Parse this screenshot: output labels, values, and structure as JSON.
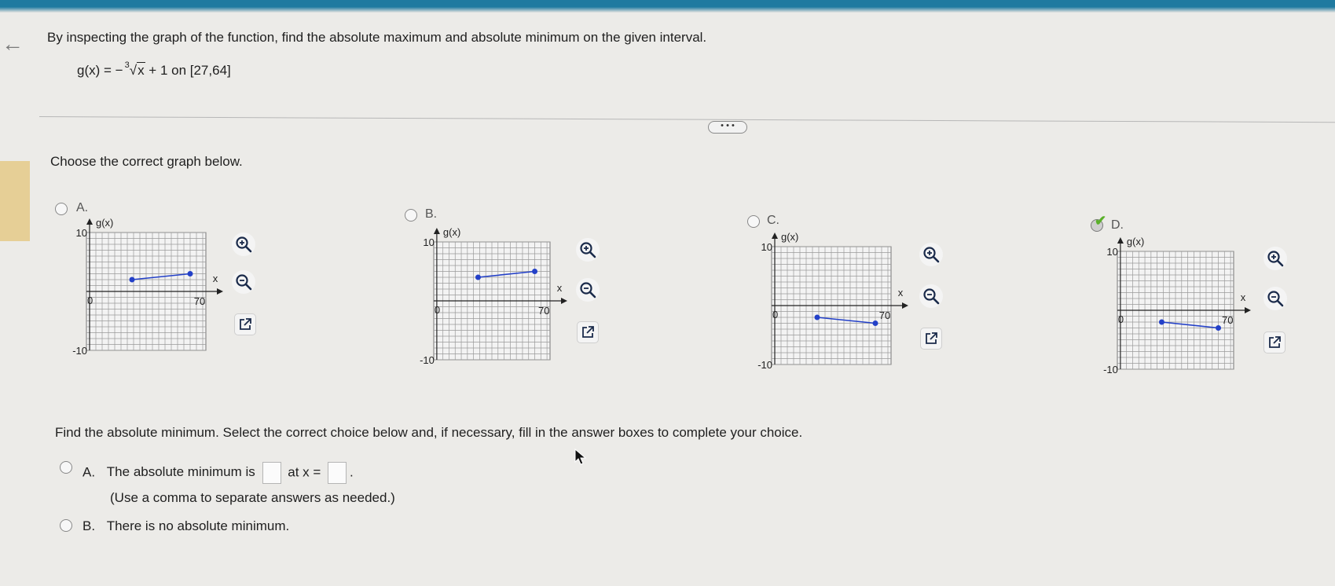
{
  "question": {
    "prompt": "By inspecting the graph of the function, find the absolute maximum and absolute minimum on the given interval.",
    "function_lhs": "g(x) = −",
    "root_index": "3",
    "radicand": "x",
    "function_rhs": "+ 1 on [27,64]"
  },
  "more_button": "• • •",
  "choose_prompt": "Choose the correct graph below.",
  "graph_options": [
    {
      "letter": "A.",
      "selected": false,
      "y_label": "g(x)",
      "x_label": "x",
      "y_max_label": "10",
      "y_min_label": "-10",
      "origin_label": "0",
      "x_max_label": "70",
      "segment": [
        [
          27,
          2.0
        ],
        [
          64,
          3.0
        ]
      ]
    },
    {
      "letter": "B.",
      "selected": false,
      "y_label": "g(x)",
      "x_label": "x",
      "y_max_label": "10",
      "y_min_label": "-10",
      "origin_label": "0",
      "x_max_label": "70",
      "segment": [
        [
          27,
          4.0
        ],
        [
          64,
          5.0
        ]
      ]
    },
    {
      "letter": "C.",
      "selected": false,
      "y_label": "g(x)",
      "x_label": "x",
      "y_max_label": "10",
      "y_min_label": "-10",
      "origin_label": "0",
      "x_max_label": "70",
      "segment": [
        [
          27,
          -2.0
        ],
        [
          64,
          -3.0
        ]
      ]
    },
    {
      "letter": "D.",
      "selected": true,
      "y_label": "g(x)",
      "x_label": "x",
      "y_max_label": "10",
      "y_min_label": "-10",
      "origin_label": "0",
      "x_max_label": "70",
      "segment": [
        [
          27,
          -2.0
        ],
        [
          64,
          -3.0
        ]
      ]
    }
  ],
  "tools": {
    "zoom_in_icon": "zoom-in-icon",
    "zoom_out_icon": "zoom-out-icon",
    "open_external_icon": "open-external-icon"
  },
  "min_question": "Find the absolute minimum. Select the correct choice below and, if necessary, fill in the answer boxes to complete your choice.",
  "answer_a": {
    "letter": "A.",
    "text_before": "The absolute minimum is",
    "text_middle": "at x =",
    "text_end": ".",
    "value_input": "",
    "x_input": "",
    "hint": "(Use a comma to separate answers as needed.)"
  },
  "answer_b": {
    "letter": "B.",
    "text": "There is no absolute minimum."
  },
  "colors": {
    "top_bar": "#1f7aa0",
    "segment": "#2340c8",
    "check": "#5ab02a",
    "grid": "#9a9a9a"
  }
}
